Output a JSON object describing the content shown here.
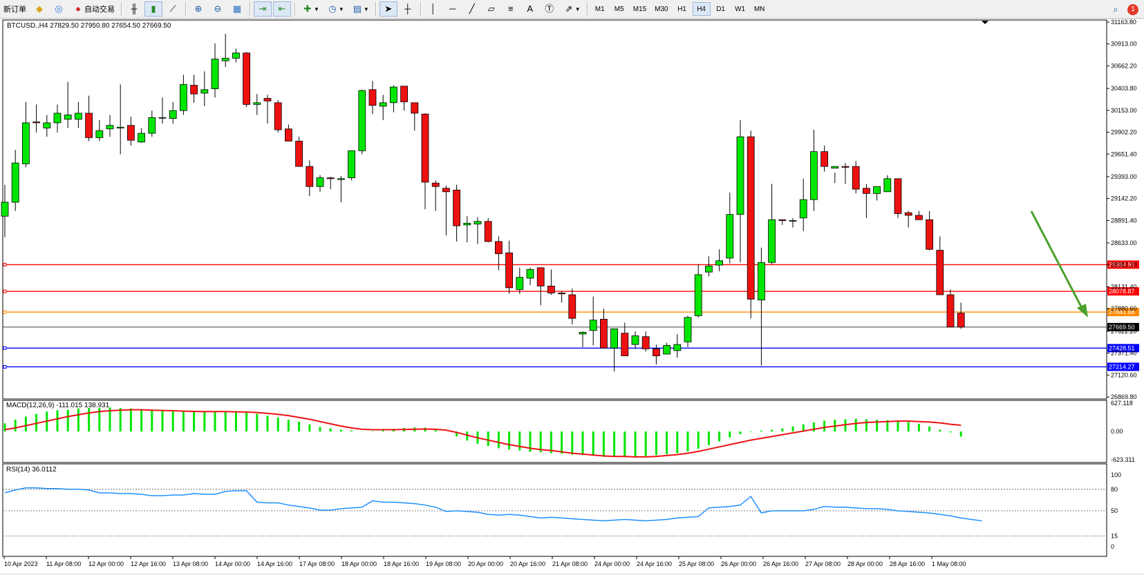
{
  "toolbar": {
    "new_order_label": "新订单",
    "auto_trading_label": "自动交易",
    "timeframes": [
      "M1",
      "M5",
      "M15",
      "M30",
      "H1",
      "H4",
      "D1",
      "W1",
      "MN"
    ],
    "active_timeframe": "H4",
    "notifications_count": "1",
    "icons": [
      "bar-chart-icon",
      "candlestick-icon",
      "line-chart-icon",
      "zoom-in-icon",
      "zoom-out-icon",
      "tile-windows-icon",
      "autoscroll-icon",
      "chart-shift-icon",
      "indicators-icon",
      "periods-icon",
      "templates-icon",
      "cursor-icon",
      "crosshair-icon",
      "vertical-line-icon",
      "horizontal-line-icon",
      "trendline-icon",
      "equidistant-channel-icon",
      "fibonacci-icon",
      "text-icon",
      "text-label-icon",
      "arrows-icon",
      "search-icon"
    ]
  },
  "chart": {
    "header": "BTCUSD.,H4  27829.50 27950.80 27654.50 27669.50",
    "macd_label": "MACD(12,26,9) -111.015 138.931",
    "rsi_label": "RSI(14) 36.0112",
    "current_price_label": "27669.50",
    "colors": {
      "bull": "#00e600",
      "bear": "#ee1111",
      "macd_hist": "#00e600",
      "signal": "#ee1111",
      "rsi": "#1e90ff",
      "resistance": "#ff0000",
      "pivot": "#ff8c00",
      "support": "#0000ff",
      "arrow": "#4aa02c"
    }
  },
  "chart_data": [
    {
      "type": "candlestick",
      "symbol": "BTCUSD.",
      "timeframe": "H4",
      "ylim": [
        26869.8,
        31163.8
      ],
      "yticks": [
        "31163.80",
        "30913.00",
        "30662.20",
        "30403.80",
        "30153.00",
        "29902.20",
        "29651.40",
        "29393.00",
        "29142.20",
        "28891.40",
        "28633.00",
        "28382.20",
        "28131.40",
        "27880.60",
        "27622.20",
        "27371.40",
        "27120.60",
        "26869.80"
      ],
      "xticks": [
        "10 Apr 2023",
        "11 Apr 08:00",
        "12 Apr 00:00",
        "12 Apr 16:00",
        "13 Apr 08:00",
        "14 Apr 00:00",
        "14 Apr 16:00",
        "17 Apr 08:00",
        "18 Apr 00:00",
        "18 Apr 16:00",
        "19 Apr 08:00",
        "20 Apr 00:00",
        "20 Apr 16:00",
        "21 Apr 08:00",
        "24 Apr 00:00",
        "24 Apr 16:00",
        "25 Apr 08:00",
        "26 Apr 00:00",
        "26 Apr 16:00",
        "27 Apr 08:00",
        "28 Apr 00:00",
        "28 Apr 16:00",
        "1 May 08:00"
      ],
      "candles": [
        [
          28940,
          29300,
          28700,
          29100
        ],
        [
          29100,
          29700,
          29000,
          29550
        ],
        [
          29540,
          30250,
          29500,
          30010
        ],
        [
          30020,
          30220,
          29900,
          30010
        ],
        [
          29950,
          30100,
          29850,
          30010
        ],
        [
          30010,
          30220,
          29900,
          30120
        ],
        [
          30050,
          30480,
          29950,
          30100
        ],
        [
          30050,
          30250,
          29950,
          30120
        ],
        [
          30120,
          30320,
          29800,
          29840
        ],
        [
          29840,
          30040,
          29800,
          29920
        ],
        [
          29940,
          30100,
          29850,
          29980
        ],
        [
          29950,
          30450,
          29650,
          29960
        ],
        [
          29980,
          30080,
          29750,
          29810
        ],
        [
          29790,
          29950,
          29780,
          29890
        ],
        [
          29890,
          30150,
          29850,
          30070
        ],
        [
          30070,
          30300,
          30000,
          30070
        ],
        [
          30060,
          30250,
          30000,
          30150
        ],
        [
          30150,
          30560,
          30100,
          30450
        ],
        [
          30440,
          30560,
          30240,
          30340
        ],
        [
          30350,
          30600,
          30200,
          30390
        ],
        [
          30400,
          30920,
          30300,
          30740
        ],
        [
          30720,
          31030,
          30650,
          30750
        ],
        [
          30750,
          30860,
          30700,
          30810
        ],
        [
          30810,
          30820,
          30190,
          30220
        ],
        [
          30220,
          30340,
          30100,
          30240
        ],
        [
          30290,
          30330,
          30000,
          30260
        ],
        [
          30240,
          30270,
          29900,
          29930
        ],
        [
          29940,
          29990,
          29810,
          29800
        ],
        [
          29800,
          29850,
          29580,
          29510
        ],
        [
          29510,
          29580,
          29170,
          29280
        ],
        [
          29280,
          29410,
          29220,
          29380
        ],
        [
          29380,
          29390,
          29250,
          29370
        ],
        [
          29360,
          29400,
          29100,
          29370
        ],
        [
          29380,
          29600,
          29350,
          29690
        ],
        [
          29690,
          30390,
          29650,
          30380
        ],
        [
          30390,
          30490,
          30110,
          30210
        ],
        [
          30200,
          30330,
          30040,
          30240
        ],
        [
          30240,
          30440,
          30130,
          30420
        ],
        [
          30430,
          30420,
          30150,
          30250
        ],
        [
          30240,
          30210,
          29920,
          30120
        ],
        [
          30110,
          30120,
          29020,
          29330
        ],
        [
          29320,
          29350,
          29000,
          29280
        ],
        [
          29260,
          29290,
          28720,
          29220
        ],
        [
          29240,
          29300,
          28650,
          28830
        ],
        [
          28840,
          28940,
          28640,
          28860
        ],
        [
          28850,
          28930,
          28620,
          28880
        ],
        [
          28880,
          28920,
          28640,
          28650
        ],
        [
          28650,
          28710,
          28320,
          28510
        ],
        [
          28520,
          28660,
          28050,
          28120
        ],
        [
          28100,
          28350,
          28050,
          28240
        ],
        [
          28230,
          28350,
          28150,
          28330
        ],
        [
          28350,
          28330,
          27920,
          28140
        ],
        [
          28140,
          28330,
          28040,
          28060
        ],
        [
          28060,
          28080,
          27950,
          28050
        ],
        [
          28040,
          28110,
          27700,
          27770
        ],
        [
          27590,
          27620,
          27440,
          27610
        ],
        [
          27630,
          28020,
          27460,
          27750
        ],
        [
          27760,
          27880,
          27630,
          27430
        ],
        [
          27430,
          27560,
          27160,
          27650
        ],
        [
          27600,
          27720,
          27360,
          27340
        ],
        [
          27470,
          27620,
          27420,
          27570
        ],
        [
          27560,
          27620,
          27390,
          27420
        ],
        [
          27420,
          27470,
          27240,
          27340
        ],
        [
          27360,
          27490,
          27370,
          27460
        ],
        [
          27400,
          27590,
          27320,
          27470
        ],
        [
          27500,
          27800,
          27440,
          27780
        ],
        [
          27800,
          28390,
          27780,
          28270
        ],
        [
          28300,
          28480,
          28250,
          28370
        ],
        [
          28380,
          28560,
          28310,
          28430
        ],
        [
          28460,
          29210,
          28400,
          28960
        ],
        [
          28960,
          30040,
          28410,
          29850
        ],
        [
          29850,
          29920,
          27770,
          27990
        ],
        [
          27980,
          28580,
          27230,
          28410
        ],
        [
          28410,
          29310,
          28390,
          28900
        ],
        [
          28900,
          28890,
          28840,
          28890
        ],
        [
          28890,
          28920,
          28810,
          28890
        ],
        [
          28920,
          29370,
          28770,
          29130
        ],
        [
          29130,
          29930,
          29000,
          29680
        ],
        [
          29680,
          29750,
          29450,
          29510
        ],
        [
          29490,
          29440,
          29320,
          29510
        ],
        [
          29510,
          29550,
          29310,
          29500
        ],
        [
          29510,
          29570,
          29200,
          29250
        ],
        [
          29260,
          29310,
          28920,
          29200
        ],
        [
          29200,
          29280,
          29120,
          29280
        ],
        [
          29220,
          29410,
          29270,
          29370
        ],
        [
          29370,
          29350,
          28920,
          28970
        ],
        [
          28980,
          29000,
          28810,
          28950
        ],
        [
          28950,
          29000,
          28930,
          28900
        ],
        [
          28900,
          29000,
          28550,
          28560
        ],
        [
          28550,
          28710,
          28130,
          28040
        ],
        [
          28040,
          28100,
          27730,
          27670
        ],
        [
          27830,
          27950,
          27650,
          27670
        ]
      ],
      "lines": [
        {
          "name": "resistance-1",
          "value": 28384.93,
          "label": "28384.93",
          "color": "#ff0000"
        },
        {
          "name": "resistance-2",
          "value": 28078.87,
          "label": "28078.87",
          "color": "#ff0000"
        },
        {
          "name": "pivot",
          "value": 27841.68,
          "label": "27841.68",
          "color": "#ff8c00"
        },
        {
          "name": "support-1",
          "value": 27428.51,
          "label": "27428.51",
          "color": "#0000ff"
        },
        {
          "name": "support-2",
          "value": 27214.27,
          "label": "27214.27",
          "color": "#0000ff"
        }
      ],
      "current_price": 27669.5
    },
    {
      "type": "bar",
      "name": "MACD(12,26,9)",
      "ylim": [
        -623.311,
        627.118
      ],
      "yticks": [
        "627.118",
        "0.00",
        "-623.311"
      ],
      "histogram": [
        180,
        260,
        330,
        390,
        440,
        470,
        480,
        510,
        520,
        520,
        530,
        520,
        510,
        480,
        470,
        460,
        450,
        440,
        430,
        430,
        440,
        450,
        440,
        420,
        390,
        350,
        310,
        260,
        220,
        160,
        100,
        70,
        40,
        20,
        5,
        10,
        30,
        60,
        80,
        90,
        85,
        60,
        0,
        -110,
        -200,
        -270,
        -320,
        -370,
        -400,
        -420,
        -450,
        -460,
        -480,
        -490,
        -510,
        -520,
        -530,
        -560,
        -560,
        -570,
        -560,
        -540,
        -520,
        -500,
        -480,
        -440,
        -380,
        -300,
        -220,
        -130,
        -60,
        -10,
        20,
        40,
        70,
        110,
        160,
        200,
        240,
        260,
        270,
        280,
        270,
        260,
        250,
        230,
        210,
        170,
        110,
        40,
        -20,
        -111
      ],
      "signal": [
        40,
        80,
        130,
        180,
        230,
        280,
        330,
        370,
        410,
        440,
        460,
        470,
        480,
        480,
        470,
        465,
        460,
        450,
        445,
        440,
        440,
        440,
        435,
        430,
        420,
        400,
        380,
        350,
        310,
        270,
        220,
        170,
        120,
        80,
        50,
        40,
        40,
        40,
        45,
        50,
        55,
        50,
        30,
        -20,
        -80,
        -140,
        -190,
        -240,
        -290,
        -330,
        -370,
        -400,
        -420,
        -450,
        -480,
        -500,
        -520,
        -540,
        -550,
        -550,
        -560,
        -560,
        -550,
        -530,
        -510,
        -480,
        -440,
        -390,
        -340,
        -290,
        -240,
        -190,
        -150,
        -110,
        -70,
        -30,
        10,
        50,
        90,
        120,
        150,
        180,
        200,
        210,
        220,
        230,
        230,
        220,
        210,
        190,
        160,
        138.931
      ]
    },
    {
      "type": "line",
      "name": "RSI(14)",
      "ylim": [
        0,
        100
      ],
      "levels": [
        80,
        50,
        15
      ],
      "yticks": [
        "100",
        "80",
        "50",
        "15",
        "0"
      ],
      "values": [
        75,
        79,
        82,
        82,
        81,
        81,
        80,
        80,
        79,
        75,
        75,
        74,
        74,
        73,
        71,
        71,
        72,
        72,
        74,
        73,
        73,
        77,
        78,
        78,
        62,
        61,
        61,
        58,
        56,
        54,
        51,
        51,
        53,
        54,
        55,
        64,
        62,
        62,
        61,
        60,
        58,
        55,
        49,
        50,
        49,
        48,
        45,
        44,
        45,
        44,
        42,
        40,
        41,
        40,
        39,
        38,
        37,
        36,
        37,
        38,
        37,
        36,
        37,
        38,
        40,
        41,
        42,
        54,
        55,
        56,
        58,
        70,
        47,
        50,
        50,
        50,
        50,
        52,
        56,
        55,
        55,
        54,
        53,
        53,
        52,
        50,
        49,
        48,
        47,
        45,
        43,
        40,
        38,
        36
      ]
    }
  ]
}
